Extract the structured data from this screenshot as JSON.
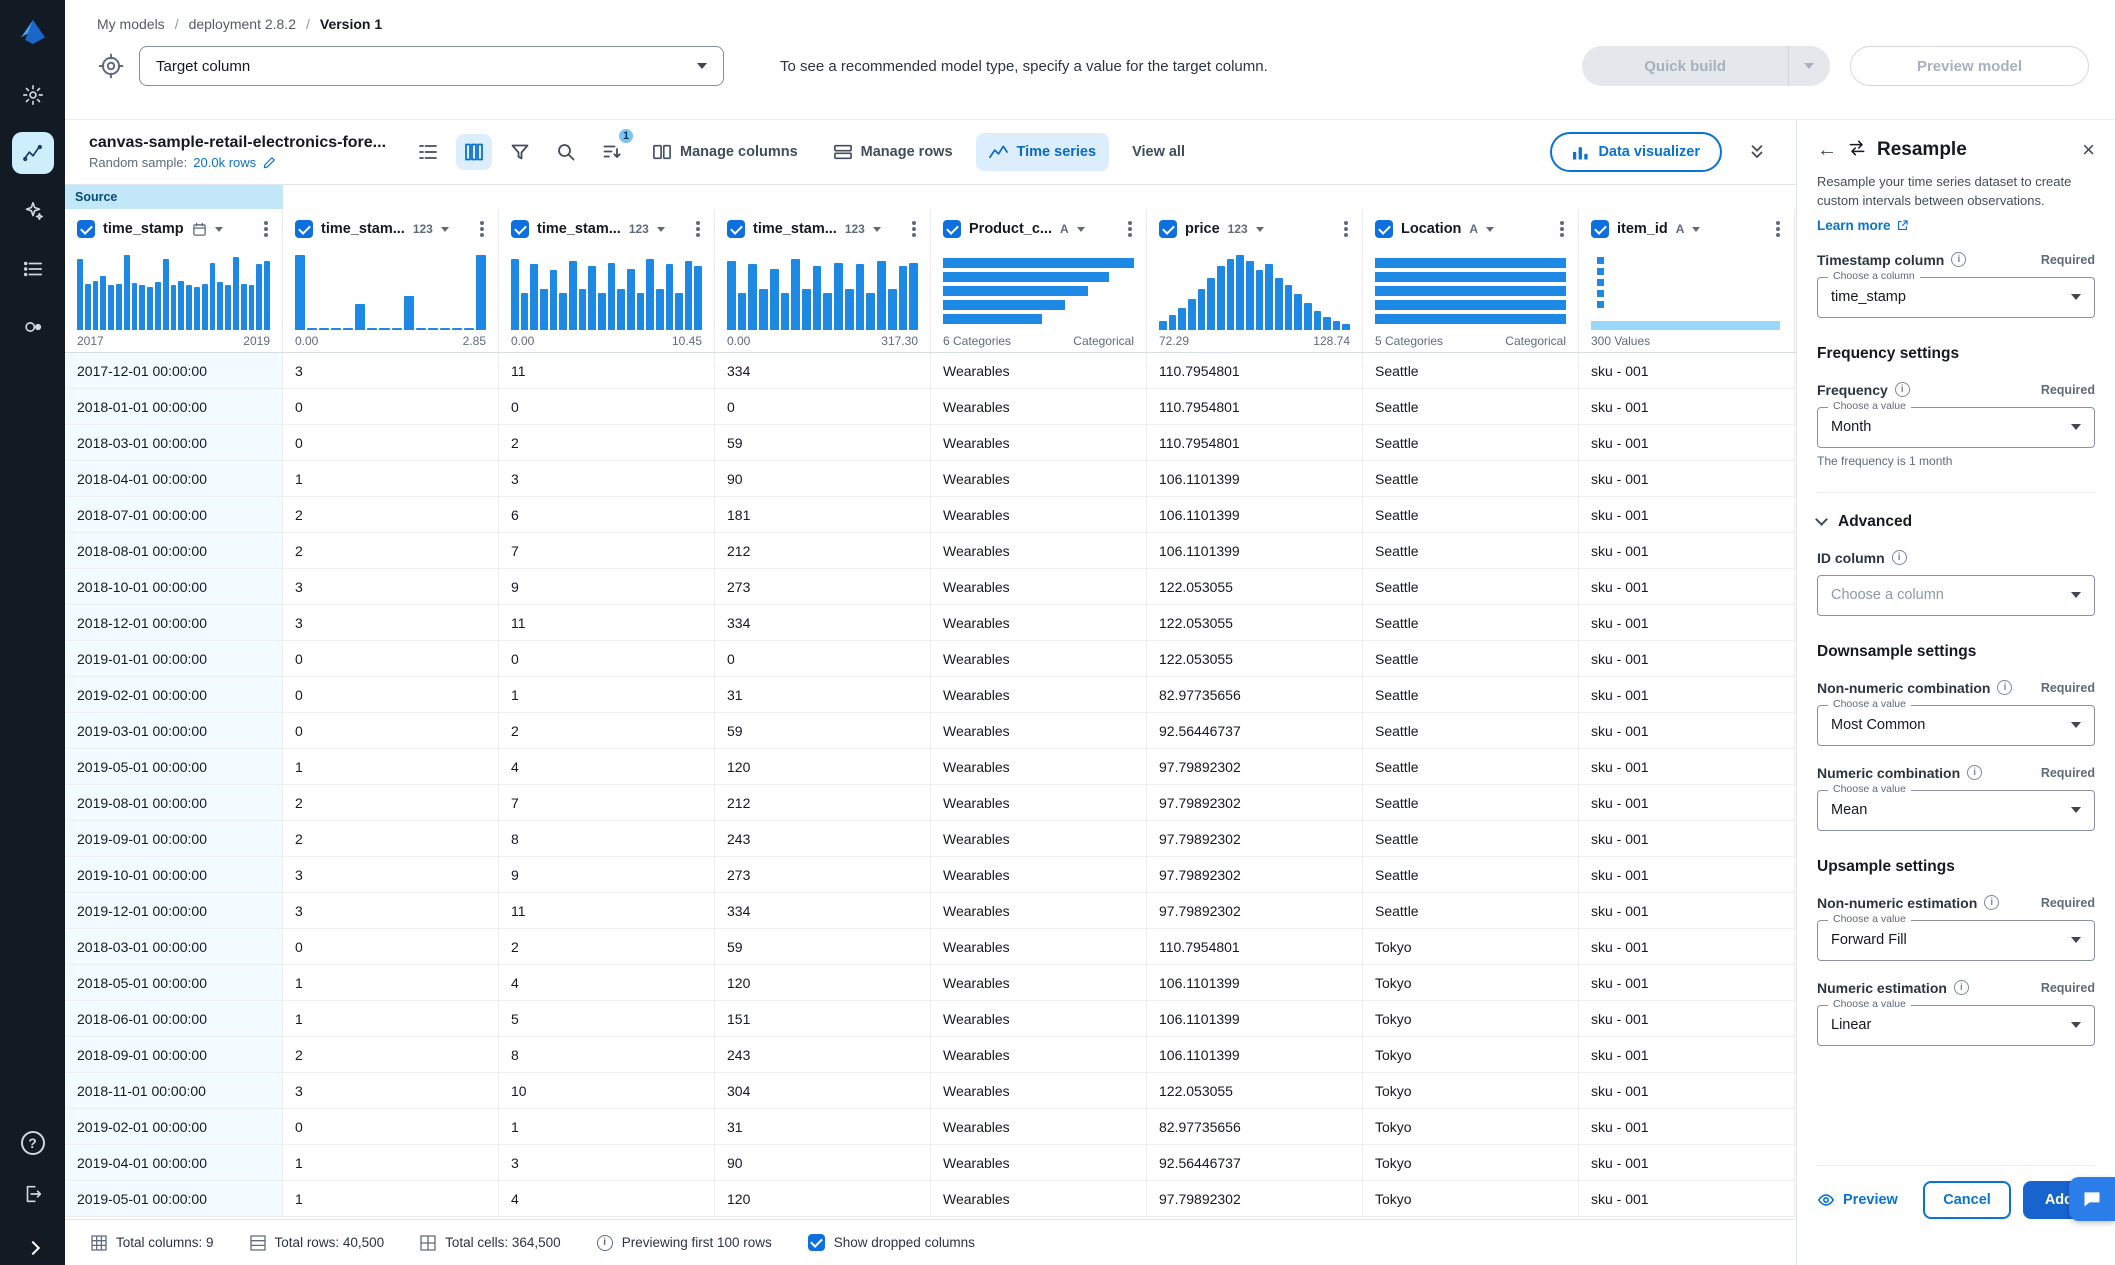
{
  "icons": {
    "close": "×",
    "back": "←",
    "help": "?"
  },
  "breadcrumb": {
    "separator": "/",
    "items": [
      "My models",
      "deployment 2.8.2",
      "Version 1"
    ]
  },
  "target_bar": {
    "dropdown_value": "Target column",
    "hint": "To see a recommended model type, specify a value for the target column.",
    "quick_build_label": "Quick build",
    "preview_model_label": "Preview model"
  },
  "toolbar": {
    "dataset_name": "canvas-sample-retail-electronics-fore...",
    "random_sample_label": "Random sample:",
    "random_sample_value": "20.0k rows",
    "sort_badge": "1",
    "manage_columns_label": "Manage columns",
    "manage_rows_label": "Manage rows",
    "time_series_label": "Time series",
    "view_all_label": "View all",
    "data_visualizer_label": "Data visualizer"
  },
  "table": {
    "source_tag": "Source",
    "columns": [
      {
        "name": "time_stamp",
        "type": "date",
        "hist": {
          "kind": "vbars",
          "values": [
            0.95,
            0.62,
            0.66,
            0.72,
            0.6,
            0.62,
            1.0,
            0.63,
            0.6,
            0.58,
            0.64,
            0.95,
            0.6,
            0.66,
            0.6,
            0.58,
            0.62,
            0.9,
            0.64,
            0.6,
            0.97,
            0.62,
            0.6,
            0.88,
            0.92
          ],
          "min": "2017",
          "max": "2019"
        }
      },
      {
        "name": "time_stam...",
        "type": "123",
        "hist": {
          "kind": "vbars",
          "values": [
            1,
            0.03,
            0.03,
            0.03,
            0.03,
            0.35,
            0.03,
            0.03,
            0.03,
            0.45,
            0.03,
            0.03,
            0.03,
            0.03,
            0.03,
            1
          ],
          "min": "0.00",
          "max": "2.85"
        }
      },
      {
        "name": "time_stam...",
        "type": "123",
        "hist": {
          "kind": "vbars",
          "values": [
            0.95,
            0.5,
            0.88,
            0.55,
            0.8,
            0.5,
            0.92,
            0.55,
            0.85,
            0.5,
            0.9,
            0.55,
            0.82,
            0.5,
            0.95,
            0.55,
            0.88,
            0.5,
            0.92,
            0.85
          ],
          "min": "0.00",
          "max": "10.45"
        }
      },
      {
        "name": "time_stam...",
        "type": "123",
        "hist": {
          "kind": "vbars",
          "values": [
            0.92,
            0.5,
            0.88,
            0.55,
            0.82,
            0.5,
            0.95,
            0.55,
            0.85,
            0.5,
            0.9,
            0.55,
            0.88,
            0.5,
            0.92,
            0.55,
            0.85,
            0.9
          ],
          "min": "0.00",
          "max": "317.30"
        }
      },
      {
        "name": "Product_c...",
        "type": "A",
        "hist": {
          "kind": "hbars",
          "values": [
            1,
            0.87,
            0.76,
            0.64,
            0.52
          ],
          "min": "6 Categories",
          "max": "Categorical"
        }
      },
      {
        "name": "price",
        "type": "123",
        "hist": {
          "kind": "vbars",
          "values": [
            0.12,
            0.2,
            0.3,
            0.42,
            0.55,
            0.7,
            0.85,
            0.95,
            1,
            0.92,
            0.8,
            0.88,
            0.7,
            0.6,
            0.48,
            0.36,
            0.26,
            0.18,
            0.12,
            0.08
          ],
          "min": "72.29",
          "max": "128.74"
        }
      },
      {
        "name": "Location",
        "type": "A",
        "hist": {
          "kind": "hbars",
          "values": [
            1,
            1,
            1,
            1,
            1
          ],
          "min": "5 Categories",
          "max": "Categorical"
        }
      },
      {
        "name": "item_id",
        "type": "A",
        "hist": {
          "kind": "item",
          "values": [],
          "min": "300 Values",
          "max": ""
        }
      }
    ],
    "rows": [
      [
        "2017-12-01 00:00:00",
        "3",
        "11",
        "334",
        "Wearables",
        "110.7954801",
        "Seattle",
        "sku - 001"
      ],
      [
        "2018-01-01 00:00:00",
        "0",
        "0",
        "0",
        "Wearables",
        "110.7954801",
        "Seattle",
        "sku - 001"
      ],
      [
        "2018-03-01 00:00:00",
        "0",
        "2",
        "59",
        "Wearables",
        "110.7954801",
        "Seattle",
        "sku - 001"
      ],
      [
        "2018-04-01 00:00:00",
        "1",
        "3",
        "90",
        "Wearables",
        "106.1101399",
        "Seattle",
        "sku - 001"
      ],
      [
        "2018-07-01 00:00:00",
        "2",
        "6",
        "181",
        "Wearables",
        "106.1101399",
        "Seattle",
        "sku - 001"
      ],
      [
        "2018-08-01 00:00:00",
        "2",
        "7",
        "212",
        "Wearables",
        "106.1101399",
        "Seattle",
        "sku - 001"
      ],
      [
        "2018-10-01 00:00:00",
        "3",
        "9",
        "273",
        "Wearables",
        "122.053055",
        "Seattle",
        "sku - 001"
      ],
      [
        "2018-12-01 00:00:00",
        "3",
        "11",
        "334",
        "Wearables",
        "122.053055",
        "Seattle",
        "sku - 001"
      ],
      [
        "2019-01-01 00:00:00",
        "0",
        "0",
        "0",
        "Wearables",
        "122.053055",
        "Seattle",
        "sku - 001"
      ],
      [
        "2019-02-01 00:00:00",
        "0",
        "1",
        "31",
        "Wearables",
        "82.97735656",
        "Seattle",
        "sku - 001"
      ],
      [
        "2019-03-01 00:00:00",
        "0",
        "2",
        "59",
        "Wearables",
        "92.56446737",
        "Seattle",
        "sku - 001"
      ],
      [
        "2019-05-01 00:00:00",
        "1",
        "4",
        "120",
        "Wearables",
        "97.79892302",
        "Seattle",
        "sku - 001"
      ],
      [
        "2019-08-01 00:00:00",
        "2",
        "7",
        "212",
        "Wearables",
        "97.79892302",
        "Seattle",
        "sku - 001"
      ],
      [
        "2019-09-01 00:00:00",
        "2",
        "8",
        "243",
        "Wearables",
        "97.79892302",
        "Seattle",
        "sku - 001"
      ],
      [
        "2019-10-01 00:00:00",
        "3",
        "9",
        "273",
        "Wearables",
        "97.79892302",
        "Seattle",
        "sku - 001"
      ],
      [
        "2019-12-01 00:00:00",
        "3",
        "11",
        "334",
        "Wearables",
        "97.79892302",
        "Seattle",
        "sku - 001"
      ],
      [
        "2018-03-01 00:00:00",
        "0",
        "2",
        "59",
        "Wearables",
        "110.7954801",
        "Tokyo",
        "sku - 001"
      ],
      [
        "2018-05-01 00:00:00",
        "1",
        "4",
        "120",
        "Wearables",
        "106.1101399",
        "Tokyo",
        "sku - 001"
      ],
      [
        "2018-06-01 00:00:00",
        "1",
        "5",
        "151",
        "Wearables",
        "106.1101399",
        "Tokyo",
        "sku - 001"
      ],
      [
        "2018-09-01 00:00:00",
        "2",
        "8",
        "243",
        "Wearables",
        "106.1101399",
        "Tokyo",
        "sku - 001"
      ],
      [
        "2018-11-01 00:00:00",
        "3",
        "10",
        "304",
        "Wearables",
        "122.053055",
        "Tokyo",
        "sku - 001"
      ],
      [
        "2019-02-01 00:00:00",
        "0",
        "1",
        "31",
        "Wearables",
        "82.97735656",
        "Tokyo",
        "sku - 001"
      ],
      [
        "2019-04-01 00:00:00",
        "1",
        "3",
        "90",
        "Wearables",
        "92.56446737",
        "Tokyo",
        "sku - 001"
      ],
      [
        "2019-05-01 00:00:00",
        "1",
        "4",
        "120",
        "Wearables",
        "97.79892302",
        "Tokyo",
        "sku - 001"
      ]
    ]
  },
  "status_bar": {
    "total_columns": "Total columns: 9",
    "total_rows": "Total rows: 40,500",
    "total_cells": "Total cells: 364,500",
    "previewing": "Previewing first 100 rows",
    "show_dropped": "Show dropped columns"
  },
  "panel": {
    "title": "Resample",
    "description": "Resample your time series dataset to create custom intervals between observations.",
    "learn_more": "Learn more",
    "required_label": "Required",
    "blocks": [
      {
        "kind": "field",
        "label": "Timestamp column",
        "required": true,
        "float": "Choose a column",
        "value": "time_stamp"
      },
      {
        "kind": "section",
        "label": "Frequency settings"
      },
      {
        "kind": "field",
        "label": "Frequency",
        "required": true,
        "float": "Choose a value",
        "value": "Month",
        "helper": "The frequency is 1 month"
      },
      {
        "kind": "divider"
      },
      {
        "kind": "collapse",
        "label": "Advanced"
      },
      {
        "kind": "field",
        "label": "ID column",
        "required": false,
        "value": "Choose a column",
        "placeholder": true
      },
      {
        "kind": "section",
        "label": "Downsample settings"
      },
      {
        "kind": "field",
        "label": "Non-numeric combination",
        "required": true,
        "float": "Choose a value",
        "value": "Most Common"
      },
      {
        "kind": "field",
        "label": "Numeric combination",
        "required": true,
        "float": "Choose a value",
        "value": "Mean"
      },
      {
        "kind": "section",
        "label": "Upsample settings"
      },
      {
        "kind": "field",
        "label": "Non-numeric estimation",
        "required": true,
        "float": "Choose a value",
        "value": "Forward Fill"
      },
      {
        "kind": "field",
        "label": "Numeric estimation",
        "required": true,
        "float": "Choose a value",
        "value": "Linear"
      }
    ],
    "footer": {
      "preview": "Preview",
      "cancel": "Cancel",
      "add": "Add"
    }
  }
}
